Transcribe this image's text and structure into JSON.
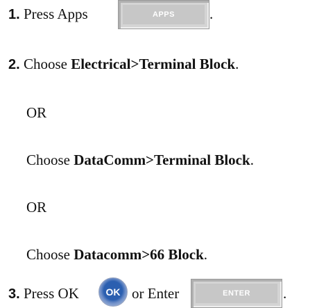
{
  "steps": [
    {
      "num": "1.",
      "text": "Press Apps",
      "key_label": "APPS"
    },
    {
      "num": "2.",
      "prefix": "Choose ",
      "bold": "Electrical>Terminal Block",
      "suffix": "."
    },
    {
      "num": "3.",
      "text1": "Press OK",
      "ok_label": "OK",
      "text2": "or Enter",
      "enter_label": "ENTER"
    }
  ],
  "or1": "OR",
  "alt1": {
    "prefix": "Choose ",
    "bold": "DataComm>Terminal Block",
    "suffix": "."
  },
  "or2": "OR",
  "alt2": {
    "prefix": "Choose ",
    "bold": "Datacomm>66 Block",
    "suffix": "."
  },
  "period": "."
}
